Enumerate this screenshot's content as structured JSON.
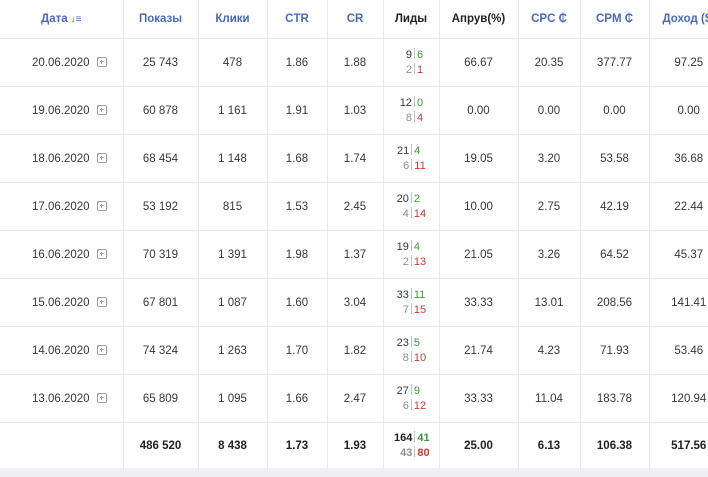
{
  "headers": {
    "date": "Дата",
    "shows": "Показы",
    "clicks": "Клики",
    "ctr": "CTR",
    "cr": "CR",
    "leads": "Лиды",
    "approve": "Апрув(%)",
    "cpc": "CPC ₵",
    "cpm": "CPM ₵",
    "income": "Доход ($)"
  },
  "rows": [
    {
      "date": "20.06.2020",
      "shows": "25 743",
      "clicks": "478",
      "ctr": "1.86",
      "cr": "1.88",
      "leads_top": "9",
      "leads_approved": "6",
      "leads_bottom": "2",
      "leads_rejected": "1",
      "approve": "66.67",
      "cpc": "20.35",
      "cpm": "377.77",
      "income": "97.25"
    },
    {
      "date": "19.06.2020",
      "shows": "60 878",
      "clicks": "1 161",
      "ctr": "1.91",
      "cr": "1.03",
      "leads_top": "12",
      "leads_approved": "0",
      "leads_bottom": "8",
      "leads_rejected": "4",
      "approve": "0.00",
      "cpc": "0.00",
      "cpm": "0.00",
      "income": "0.00"
    },
    {
      "date": "18.06.2020",
      "shows": "68 454",
      "clicks": "1 148",
      "ctr": "1.68",
      "cr": "1.74",
      "leads_top": "21",
      "leads_approved": "4",
      "leads_bottom": "6",
      "leads_rejected": "11",
      "approve": "19.05",
      "cpc": "3.20",
      "cpm": "53.58",
      "income": "36.68"
    },
    {
      "date": "17.06.2020",
      "shows": "53 192",
      "clicks": "815",
      "ctr": "1.53",
      "cr": "2.45",
      "leads_top": "20",
      "leads_approved": "2",
      "leads_bottom": "4",
      "leads_rejected": "14",
      "approve": "10.00",
      "cpc": "2.75",
      "cpm": "42.19",
      "income": "22.44"
    },
    {
      "date": "16.06.2020",
      "shows": "70 319",
      "clicks": "1 391",
      "ctr": "1.98",
      "cr": "1.37",
      "leads_top": "19",
      "leads_approved": "4",
      "leads_bottom": "2",
      "leads_rejected": "13",
      "approve": "21.05",
      "cpc": "3.26",
      "cpm": "64.52",
      "income": "45.37"
    },
    {
      "date": "15.06.2020",
      "shows": "67 801",
      "clicks": "1 087",
      "ctr": "1.60",
      "cr": "3.04",
      "leads_top": "33",
      "leads_approved": "11",
      "leads_bottom": "7",
      "leads_rejected": "15",
      "approve": "33.33",
      "cpc": "13.01",
      "cpm": "208.56",
      "income": "141.41"
    },
    {
      "date": "14.06.2020",
      "shows": "74 324",
      "clicks": "1 263",
      "ctr": "1.70",
      "cr": "1.82",
      "leads_top": "23",
      "leads_approved": "5",
      "leads_bottom": "8",
      "leads_rejected": "10",
      "approve": "21.74",
      "cpc": "4.23",
      "cpm": "71.93",
      "income": "53.46"
    },
    {
      "date": "13.06.2020",
      "shows": "65 809",
      "clicks": "1 095",
      "ctr": "1.66",
      "cr": "2.47",
      "leads_top": "27",
      "leads_approved": "9",
      "leads_bottom": "6",
      "leads_rejected": "12",
      "approve": "33.33",
      "cpc": "11.04",
      "cpm": "183.78",
      "income": "120.94"
    }
  ],
  "total": {
    "shows": "486 520",
    "clicks": "8 438",
    "ctr": "1.73",
    "cr": "1.93",
    "leads_top": "164",
    "leads_approved": "41",
    "leads_bottom": "43",
    "leads_rejected": "80",
    "approve": "25.00",
    "cpc": "6.13",
    "cpm": "106.38",
    "income": "517.56"
  },
  "colors": {
    "header_link": "#4a6ab8",
    "approved": "#3d9a3d",
    "rejected": "#c43b3b"
  }
}
